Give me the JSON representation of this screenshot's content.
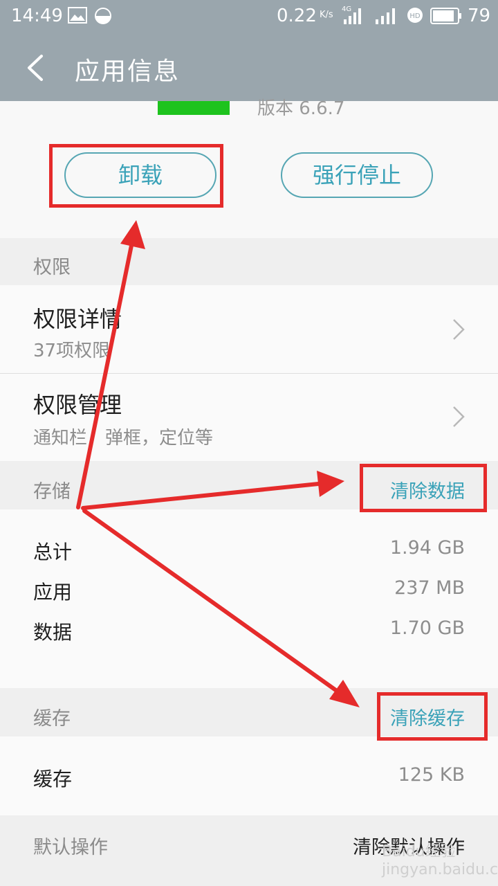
{
  "status": {
    "time": "14:49",
    "speed": "0.22",
    "speed_unit": "K/s",
    "net": "4G",
    "battery": "79"
  },
  "header": {
    "title": "应用信息"
  },
  "app": {
    "version": "版本 6.6.7"
  },
  "buttons": {
    "uninstall": "卸载",
    "force_stop": "强行停止"
  },
  "permissions": {
    "section": "权限",
    "items": [
      {
        "title": "权限详情",
        "subtitle": "37项权限"
      },
      {
        "title": "权限管理",
        "subtitle": "通知栏，弹框，定位等"
      }
    ]
  },
  "storage": {
    "section": "存储",
    "action": "清除数据",
    "rows": [
      {
        "label": "总计",
        "value": "1.94 GB"
      },
      {
        "label": "应用",
        "value": "237 MB"
      },
      {
        "label": "数据",
        "value": "1.70 GB"
      }
    ]
  },
  "cache": {
    "section": "缓存",
    "action": "清除缓存",
    "row": {
      "label": "缓存",
      "value": "125 KB"
    }
  },
  "default": {
    "section": "默认操作",
    "action": "清除默认操作"
  },
  "watermark": "Baidu经验 jingyan.baidu.com",
  "colors": {
    "header": "#9aa6ad",
    "accent": "#3aa2b8",
    "annotation": "#e52b2b",
    "app_green": "#1ec31e"
  }
}
